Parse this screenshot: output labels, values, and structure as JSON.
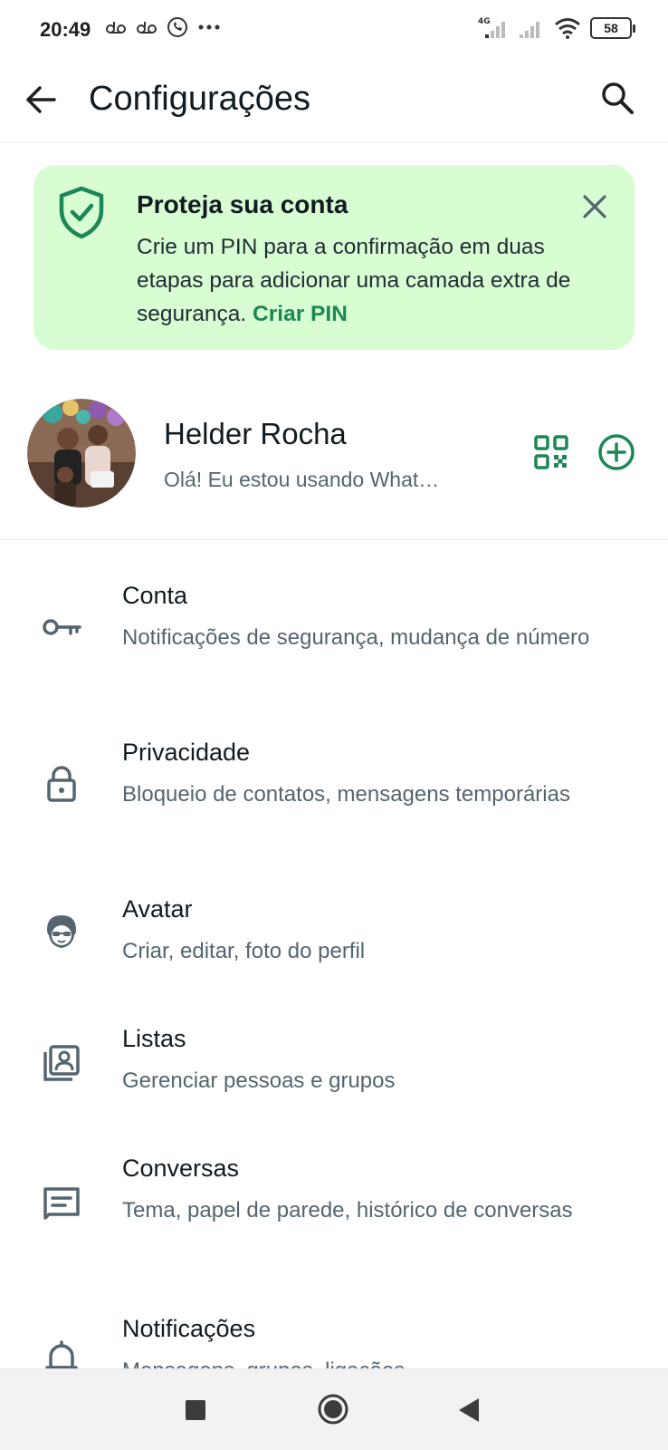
{
  "status_bar": {
    "time": "20:49",
    "network": "4G",
    "battery": "58"
  },
  "header": {
    "title": "Configurações"
  },
  "banner": {
    "title": "Proteja sua conta",
    "text": "Crie um PIN para a confirmação em duas etapas para adicionar uma camada extra de segurança.",
    "link": "Criar PIN"
  },
  "profile": {
    "name": "Helder Rocha",
    "status": "Olá! Eu estou usando What…"
  },
  "settings": [
    {
      "title": "Conta",
      "subtitle": "Notificações de segurança, mudança de número",
      "icon": "key-icon"
    },
    {
      "title": "Privacidade",
      "subtitle": "Bloqueio de contatos, mensagens temporárias",
      "icon": "lock-icon"
    },
    {
      "title": "Avatar",
      "subtitle": "Criar, editar, foto do perfil",
      "icon": "avatar-face-icon"
    },
    {
      "title": "Listas",
      "subtitle": "Gerenciar pessoas e grupos",
      "icon": "contacts-list-icon"
    },
    {
      "title": "Conversas",
      "subtitle": "Tema, papel de parede, histórico de conversas",
      "icon": "chat-icon"
    },
    {
      "title": "Notificações",
      "subtitle": "Mensagens, grupos, ligações",
      "icon": "bell-icon"
    }
  ],
  "colors": {
    "accent": "#1b8755",
    "banner_bg": "#d9fdd3",
    "text_primary": "#111b21",
    "text_secondary": "#54656f"
  }
}
